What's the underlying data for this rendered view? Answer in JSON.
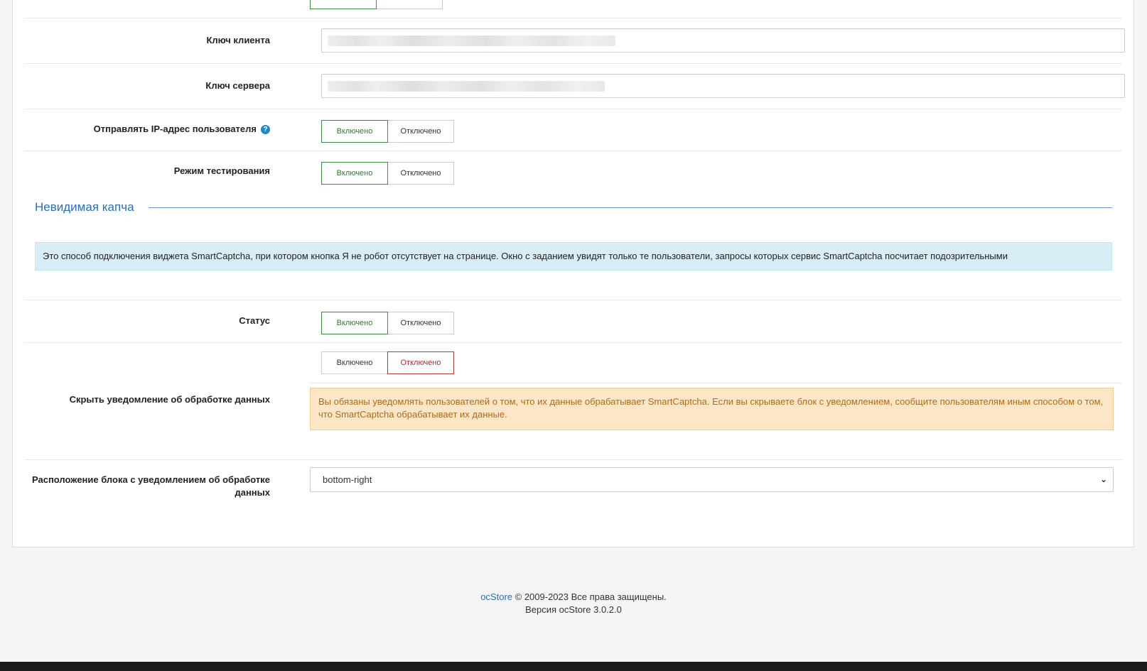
{
  "toggle": {
    "on": "Включено",
    "off": "Отключено"
  },
  "fields": {
    "client_key": "Ключ клиента",
    "server_key": "Ключ сервера",
    "send_ip": "Отправлять IP-адрес пользователя",
    "test_mode": "Режим тестирования",
    "status": "Статус",
    "hide_notice": "Скрыть уведомление об обработке данных",
    "notice_position": "Расположение блока с уведомлением об обработке данных"
  },
  "section": {
    "title": "Невидимая капча",
    "info": "Это способ подключения виджета SmartCaptcha, при котором кнопка Я не робот отсутствует на странице. Окно с заданием увидят только те пользователи, запросы которых сервис SmartCaptcha посчитает подозрительными"
  },
  "warning": "Вы обязаны уведомлять пользователей о том, что их данные обрабатывает SmartCaptcha. Если вы скрываете блок с уведомлением, сообщите пользователям иным способом о том, что SmartCaptcha обрабатывает их данные.",
  "select_value": "bottom-right",
  "footer": {
    "brand": "ocStore",
    "rights": " © 2009-2023 Все права защищены.",
    "version": "Версия ocStore 3.0.2.0"
  },
  "colors": {
    "accent": "#2a6fb5",
    "on": "#3d8b3d",
    "off": "#b33a3a",
    "info_bg": "#d9edf7",
    "warn_bg": "#fde6c5"
  }
}
